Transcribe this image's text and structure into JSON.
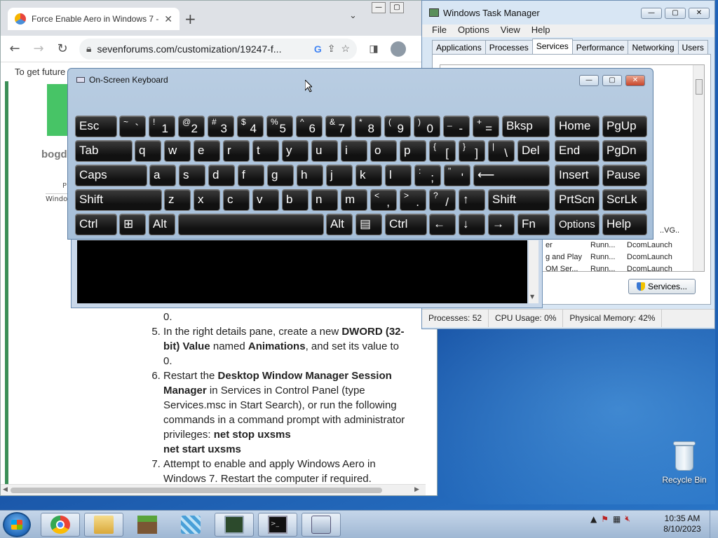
{
  "chrome": {
    "tab_title": "Force Enable Aero in Windows 7 - W",
    "new_tab": "+",
    "address": "sevenforums.com/customization/19247-f...",
    "notice": "To get future G",
    "author": "bogd",
    "small_p": "P",
    "small_w": "Windo",
    "article": {
      "zero": "0.",
      "step5_a": "In the right details pane, create a new ",
      "step5_b": "DWORD (32-bit) Value",
      "step5_c": " named ",
      "step5_d": "Animations",
      "step5_e": ", and set its value to 0.",
      "step6_a": "Restart the ",
      "step6_b": "Desktop Window Manager Session Manager",
      "step6_c": " in Services in Control Panel (type Services.msc in Start Search), or run the following commands in a command prompt with administrator privileges: ",
      "step6_d": "net stop uxsms",
      "step6_e": "net start uxsms",
      "step7": "Attempt to enable and apply Windows Aero in Windows 7. Restart the computer if required."
    }
  },
  "taskmgr": {
    "title": "Windows Task Manager",
    "menu": [
      "File",
      "Options",
      "View",
      "Help"
    ],
    "tabs": [
      "Applications",
      "Processes",
      "Services",
      "Performance",
      "Networking",
      "Users"
    ],
    "active_tab": "Services",
    "rows": [
      {
        "name": "",
        "status": "",
        "group": "..VG.."
      },
      {
        "name": "er",
        "status": "Runn...",
        "group": "DcomLaunch"
      },
      {
        "name": "g and Play",
        "status": "Runn...",
        "group": "DcomLaunch"
      },
      {
        "name": "OM Ser...",
        "status": "Runn...",
        "group": "DcomLaunch"
      }
    ],
    "services_button": "Services...",
    "status": {
      "processes": "Processes: 52",
      "cpu": "CPU Usage: 0%",
      "memory": "Physical Memory: 42%"
    }
  },
  "osk": {
    "title": "On-Screen Keyboard"
  },
  "desktop": {
    "recycle_bin": "Recycle Bin"
  },
  "taskbar": {
    "time": "10:35 AM",
    "date": "8/10/2023"
  }
}
